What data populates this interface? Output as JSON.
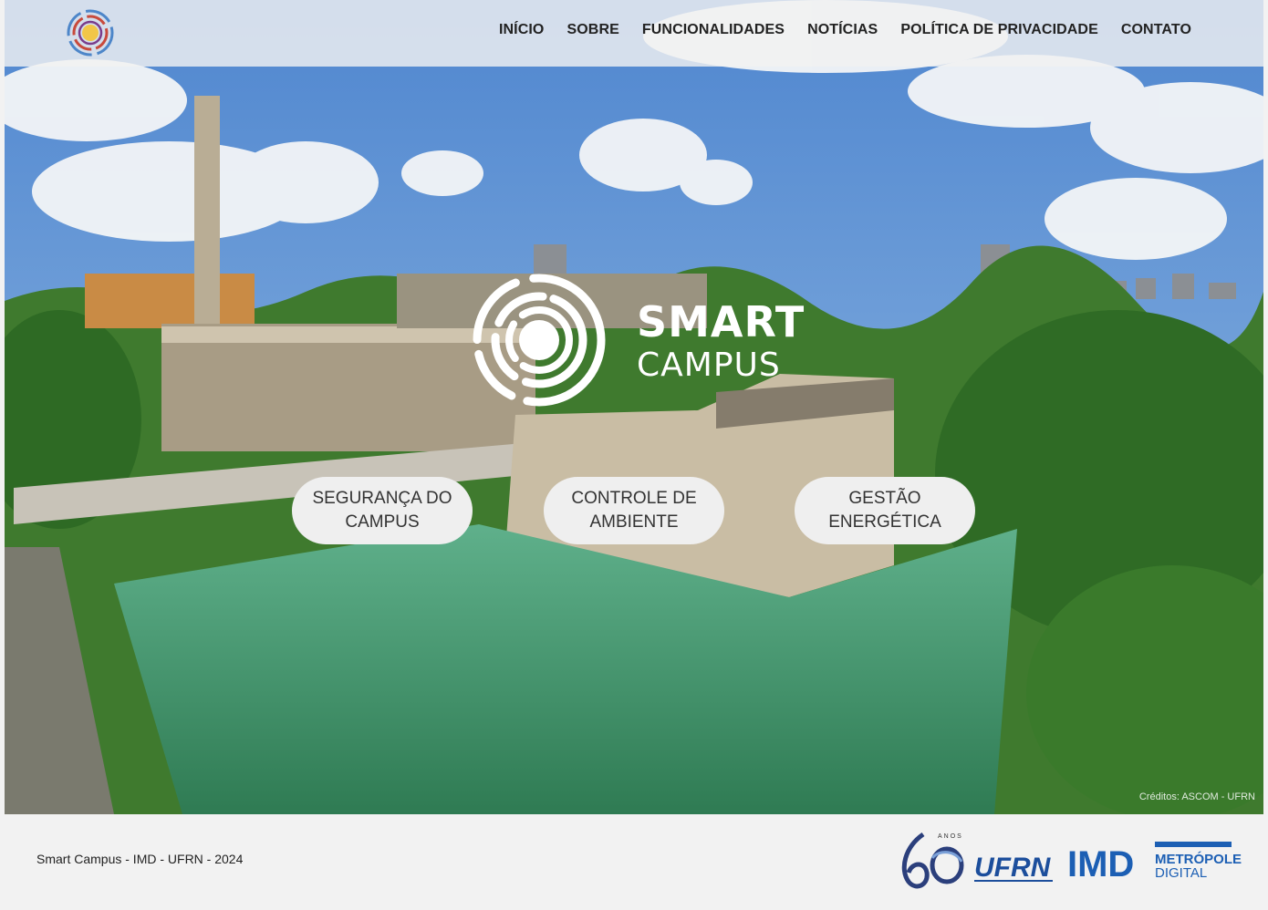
{
  "nav": {
    "items": [
      "INÍCIO",
      "SOBRE",
      "FUNCIONALIDADES",
      "NOTÍCIAS",
      "POLÍTICA DE PRIVACIDADE",
      "CONTATO"
    ]
  },
  "hero": {
    "title_line1": "SMART",
    "title_line2": "CAMPUS",
    "features": [
      "SEGURANÇA DO CAMPUS",
      "CONTROLE DE AMBIENTE",
      "GESTÃO ENERGÉTICA"
    ],
    "credits": "Créditos: ASCOM - UFRN"
  },
  "footer": {
    "text": "Smart Campus - IMD - UFRN - 2024",
    "logo_60_label": "ANOS",
    "logo_ufrn": "UFRN",
    "logo_imd": "IMD",
    "logo_metropole_line1": "METRÓPOLE",
    "logo_metropole_line2": "DIGITAL"
  },
  "colors": {
    "sky": "#5b8fd4",
    "water": "#3f8f6a",
    "foliage": "#3e7b2e",
    "concrete": "#b9ad95",
    "ufrn_blue": "#1c4e9c"
  }
}
